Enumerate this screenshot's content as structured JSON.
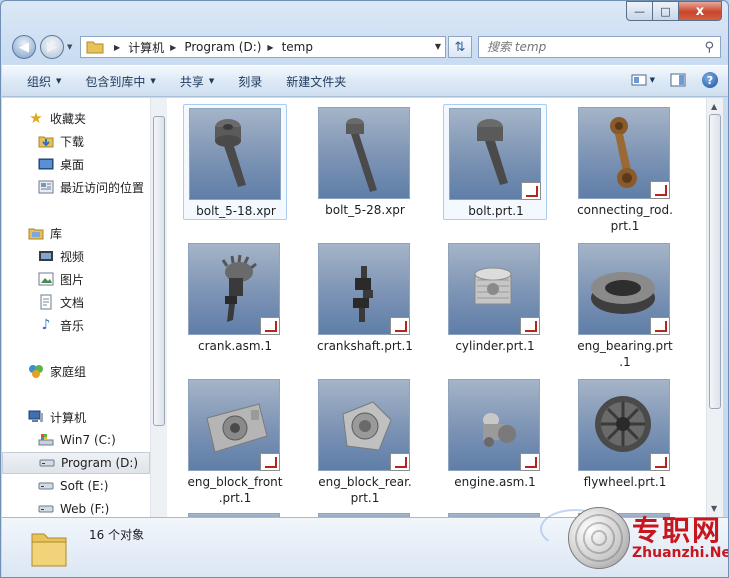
{
  "window": {
    "caption_buttons": {
      "minimize": "—",
      "maximize": "□",
      "close": "x"
    }
  },
  "address_bar": {
    "crumbs": [
      "计算机",
      "Program (D:)",
      "temp"
    ],
    "search_placeholder": "搜索 temp"
  },
  "toolbar": {
    "organize": "组织",
    "include_in_library": "包含到库中",
    "share": "共享",
    "burn": "刻录",
    "new_folder": "新建文件夹"
  },
  "nav": {
    "favorites": {
      "label": "收藏夹",
      "items": [
        "下载",
        "桌面",
        "最近访问的位置"
      ]
    },
    "libraries": {
      "label": "库",
      "items": [
        "视频",
        "图片",
        "文档",
        "音乐"
      ]
    },
    "homegroup": "家庭组",
    "computer": {
      "label": "计算机",
      "items": [
        "Win7 (C:)",
        "Program (D:)",
        "Soft (E:)",
        "Web (F:)"
      ]
    },
    "selected": "Program (D:)"
  },
  "files": [
    {
      "name": "bolt_5-18.xpr",
      "type": "bolt",
      "badge": false,
      "selected": true
    },
    {
      "name": "bolt_5-28.xpr",
      "type": "bolt-long",
      "badge": false,
      "selected": false
    },
    {
      "name": "bolt.prt.1",
      "type": "bolt",
      "badge": true,
      "selected": true
    },
    {
      "name": "connecting_rod.prt.1",
      "type": "rod",
      "badge": true,
      "selected": false
    },
    {
      "name": "crank.asm.1",
      "type": "crank",
      "badge": true,
      "selected": false
    },
    {
      "name": "crankshaft.prt.1",
      "type": "crankshaft",
      "badge": true,
      "selected": false
    },
    {
      "name": "cylinder.prt.1",
      "type": "cylinder",
      "badge": true,
      "selected": false
    },
    {
      "name": "eng_bearing.prt.1",
      "type": "bearing",
      "badge": true,
      "selected": false
    },
    {
      "name": "eng_block_front.prt.1",
      "type": "block",
      "badge": true,
      "selected": false
    },
    {
      "name": "eng_block_rear.prt.1",
      "type": "block-rear",
      "badge": true,
      "selected": false
    },
    {
      "name": "engine.asm.1",
      "type": "engine",
      "badge": true,
      "selected": false
    },
    {
      "name": "flywheel.prt.1",
      "type": "flywheel",
      "badge": true,
      "selected": false
    }
  ],
  "file_labels": [
    [
      "bolt_5-18.xpr"
    ],
    [
      "bolt_5-28.xpr"
    ],
    [
      "bolt.prt.1"
    ],
    [
      "connecting_rod.",
      "prt.1"
    ],
    [
      "crank.asm.1"
    ],
    [
      "crankshaft.prt.1"
    ],
    [
      "cylinder.prt.1"
    ],
    [
      "eng_bearing.prt",
      ".1"
    ],
    [
      "eng_block_front",
      ".prt.1"
    ],
    [
      "eng_block_rear.",
      "prt.1"
    ],
    [
      "engine.asm.1"
    ],
    [
      "flywheel.prt.1"
    ]
  ],
  "details": {
    "count_text": "16 个对象"
  },
  "watermark": {
    "cn": "专职网",
    "en": "Zhuanzhi.Net"
  },
  "colors": {
    "accent": "#1e395b",
    "watermark_red": "#c7161e",
    "thumb_bg": "#7c93b4"
  }
}
